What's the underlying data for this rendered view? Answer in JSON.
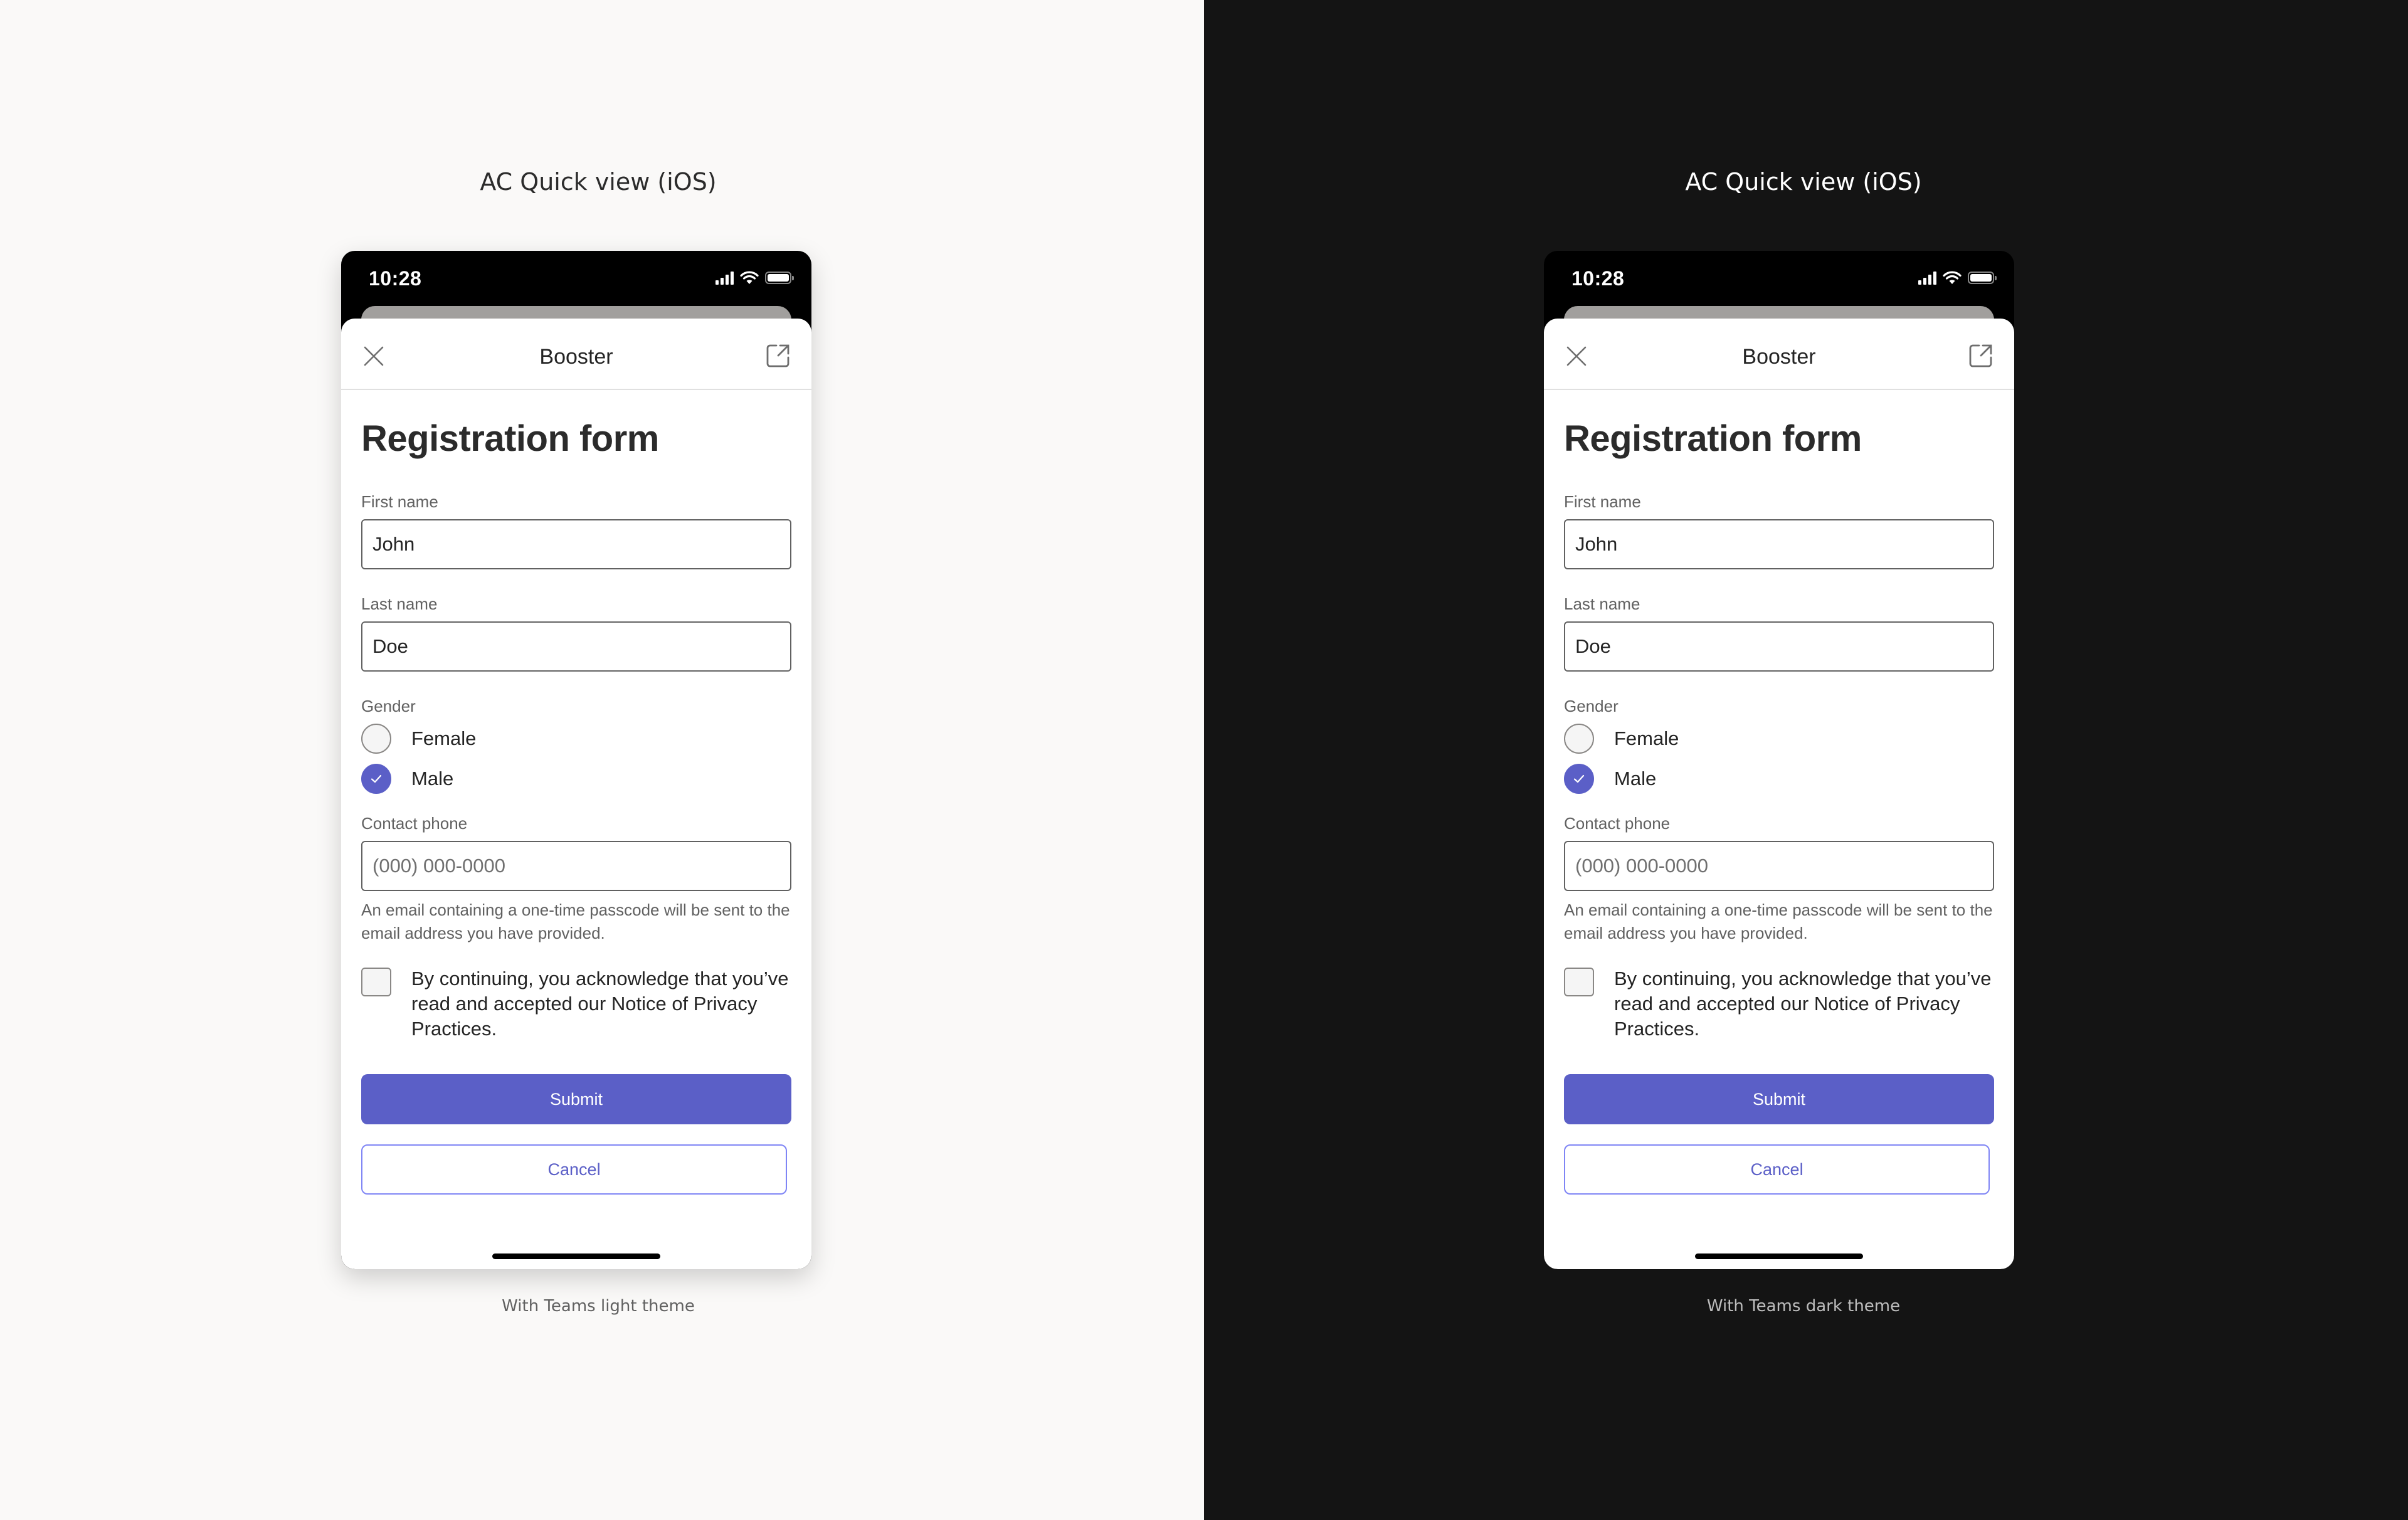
{
  "panels": [
    {
      "theme": "light",
      "title": "AC Quick view (iOS)",
      "caption": "With Teams light theme",
      "phone": {
        "status_bar": {
          "time": "10:28",
          "icons": [
            "signal-icon",
            "wifi-icon",
            "battery-icon"
          ]
        },
        "sheet": {
          "title": "Booster",
          "close_icon": "close-icon",
          "open_external_icon": "open-external-icon",
          "form": {
            "heading": "Registration form",
            "first_name": {
              "label": "First name",
              "value": "John"
            },
            "last_name": {
              "label": "Last name",
              "value": "Doe"
            },
            "gender": {
              "label": "Gender",
              "options": [
                {
                  "label": "Female",
                  "checked": false
                },
                {
                  "label": "Male",
                  "checked": true
                }
              ]
            },
            "contact_phone": {
              "label": "Contact phone",
              "value": "",
              "placeholder": "(000) 000-0000"
            },
            "help_text": "An email containing a one-time passcode will be sent to the email address you have provided.",
            "consent": {
              "label": "By continuing, you acknowledge that you’ve read and accepted our Notice of Privacy Practices.",
              "checked": false
            },
            "submit_label": "Submit",
            "cancel_label": "Cancel"
          }
        }
      }
    },
    {
      "theme": "dark",
      "title": "AC Quick view (iOS)",
      "caption": "With Teams dark theme",
      "phone": {
        "status_bar": {
          "time": "10:28",
          "icons": [
            "signal-icon",
            "wifi-icon",
            "battery-icon"
          ]
        },
        "sheet": {
          "title": "Booster",
          "close_icon": "close-icon",
          "open_external_icon": "open-external-icon",
          "form": {
            "heading": "Registration form",
            "first_name": {
              "label": "First name",
              "value": "John"
            },
            "last_name": {
              "label": "Last name",
              "value": "Doe"
            },
            "gender": {
              "label": "Gender",
              "options": [
                {
                  "label": "Female",
                  "checked": false
                },
                {
                  "label": "Male",
                  "checked": true
                }
              ]
            },
            "contact_phone": {
              "label": "Contact phone",
              "value": "",
              "placeholder": "(000) 000-0000"
            },
            "help_text": "An email containing a one-time passcode will be sent to the email address you have provided.",
            "consent": {
              "label": "By continuing, you acknowledge that you’ve read and accepted our Notice of Privacy Practices.",
              "checked": false
            },
            "submit_label": "Submit",
            "cancel_label": "Cancel"
          }
        }
      }
    }
  ],
  "colors": {
    "accent": "#5b5fc7",
    "accent_border": "#7f85f5",
    "light_background": "#faf9f8",
    "dark_background": "#141414",
    "text_primary": "#242424",
    "text_secondary": "#616161"
  }
}
